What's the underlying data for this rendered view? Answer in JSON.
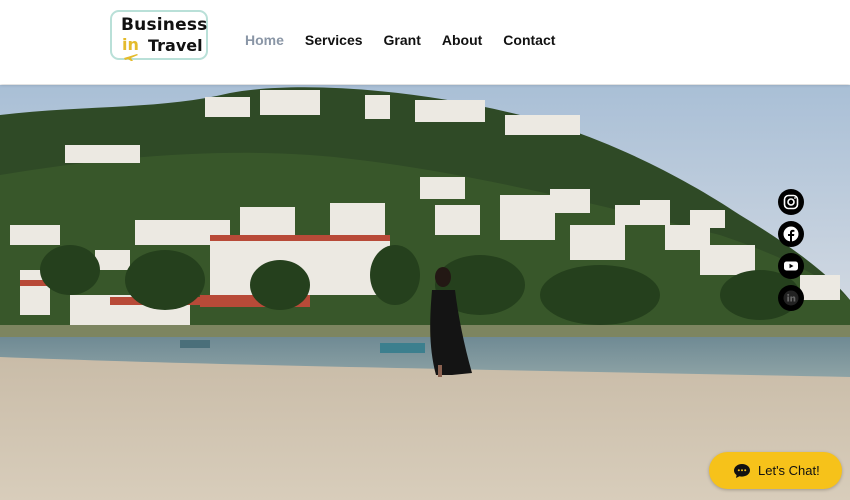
{
  "logo": {
    "line1": "Business",
    "in": "in",
    "line2": "Travel"
  },
  "nav": {
    "items": [
      {
        "label": "Home",
        "active": true
      },
      {
        "label": "Services"
      },
      {
        "label": "Grant"
      },
      {
        "label": "About"
      },
      {
        "label": "Contact"
      }
    ]
  },
  "social": {
    "icons": [
      "instagram-icon",
      "facebook-icon",
      "youtube-icon",
      "linkedin-icon"
    ]
  },
  "chat": {
    "label": "Let's Chat!",
    "icon": "chat-bubble-icon"
  },
  "colors": {
    "accent": "#f6c21a",
    "nav_active": "#8a96a6",
    "logo_border": "#b9e0d8",
    "logo_in": "#e4bb2c"
  }
}
